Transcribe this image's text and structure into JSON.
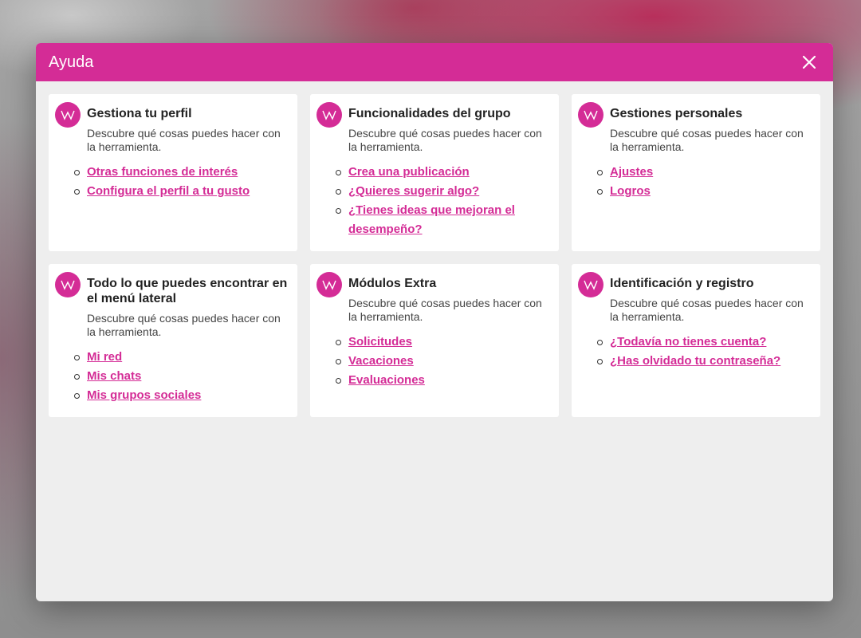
{
  "dialog": {
    "title": "Ayuda"
  },
  "colors": {
    "accent": "#d42c96"
  },
  "icons": {
    "logo": "w-logo-icon",
    "close": "close-icon"
  },
  "cards": [
    {
      "title": "Gestiona tu perfil",
      "description": "Descubre qué cosas puedes hacer con la herramienta.",
      "links": [
        "Otras funciones de interés",
        "Configura el perfil a tu gusto"
      ]
    },
    {
      "title": "Funcionalidades del grupo",
      "description": "Descubre qué cosas puedes hacer con la herramienta.",
      "links": [
        "Crea una publicación",
        "¿Quieres sugerir algo?",
        "¿Tienes ideas que mejoran el desempeño?"
      ]
    },
    {
      "title": "Gestiones personales",
      "description": "Descubre qué cosas puedes hacer con la herramienta.",
      "links": [
        "Ajustes",
        "Logros"
      ]
    },
    {
      "title": "Todo lo que puedes encontrar en el menú lateral",
      "description": "Descubre qué cosas puedes hacer con la herramienta.",
      "links": [
        "Mi red",
        "Mis chats",
        "Mis grupos sociales"
      ]
    },
    {
      "title": "Módulos Extra",
      "description": "Descubre qué cosas puedes hacer con la herramienta.",
      "links": [
        "Solicitudes",
        "Vacaciones",
        "Evaluaciones"
      ]
    },
    {
      "title": "Identificación y registro",
      "description": "Descubre qué cosas puedes hacer con la herramienta.",
      "links": [
        "¿Todavía no tienes cuenta?",
        "¿Has olvidado tu contraseña?"
      ]
    }
  ]
}
